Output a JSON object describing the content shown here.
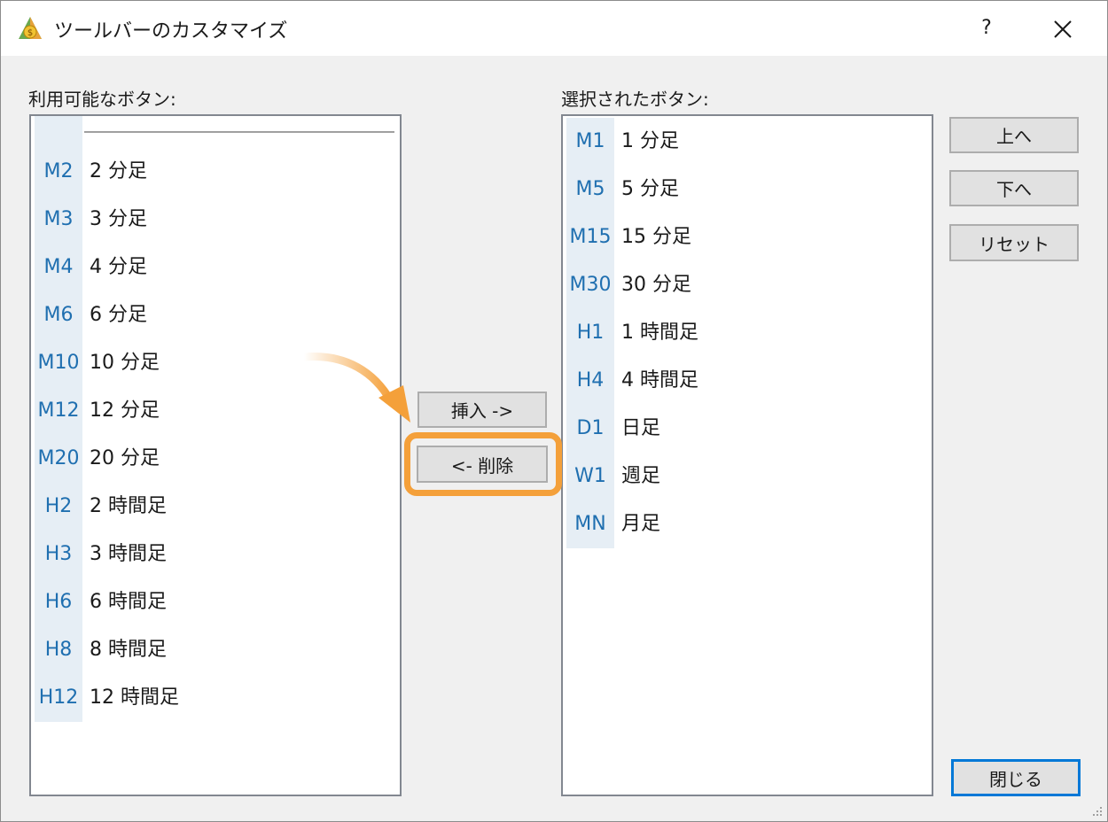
{
  "window": {
    "title": "ツールバーのカスタマイズ",
    "help_label": "?"
  },
  "available": {
    "label": "利用可能なボタン:",
    "items": [
      {
        "code": "M2",
        "label": "2 分足"
      },
      {
        "code": "M3",
        "label": "3 分足"
      },
      {
        "code": "M4",
        "label": "4 分足"
      },
      {
        "code": "M6",
        "label": "6 分足"
      },
      {
        "code": "M10",
        "label": "10 分足"
      },
      {
        "code": "M12",
        "label": "12 分足"
      },
      {
        "code": "M20",
        "label": "20 分足"
      },
      {
        "code": "H2",
        "label": "2 時間足"
      },
      {
        "code": "H3",
        "label": "3 時間足"
      },
      {
        "code": "H6",
        "label": "6 時間足"
      },
      {
        "code": "H8",
        "label": "8 時間足"
      },
      {
        "code": "H12",
        "label": "12 時間足"
      }
    ]
  },
  "selected": {
    "label": "選択されたボタン:",
    "items": [
      {
        "code": "M1",
        "label": "1 分足"
      },
      {
        "code": "M5",
        "label": "5 分足"
      },
      {
        "code": "M15",
        "label": "15 分足"
      },
      {
        "code": "M30",
        "label": "30 分足"
      },
      {
        "code": "H1",
        "label": "1 時間足"
      },
      {
        "code": "H4",
        "label": "4 時間足"
      },
      {
        "code": "D1",
        "label": "日足"
      },
      {
        "code": "W1",
        "label": "週足"
      },
      {
        "code": "MN",
        "label": "月足"
      }
    ]
  },
  "actions": {
    "insert": "挿入 ->",
    "remove": "<- 削除"
  },
  "side": {
    "up": "上へ",
    "down": "下へ",
    "reset": "リセット",
    "close": "閉じる"
  },
  "colors": {
    "code_text": "#1f6fb0",
    "highlight": "#f4a03a",
    "default_button_border": "#0078d7"
  }
}
